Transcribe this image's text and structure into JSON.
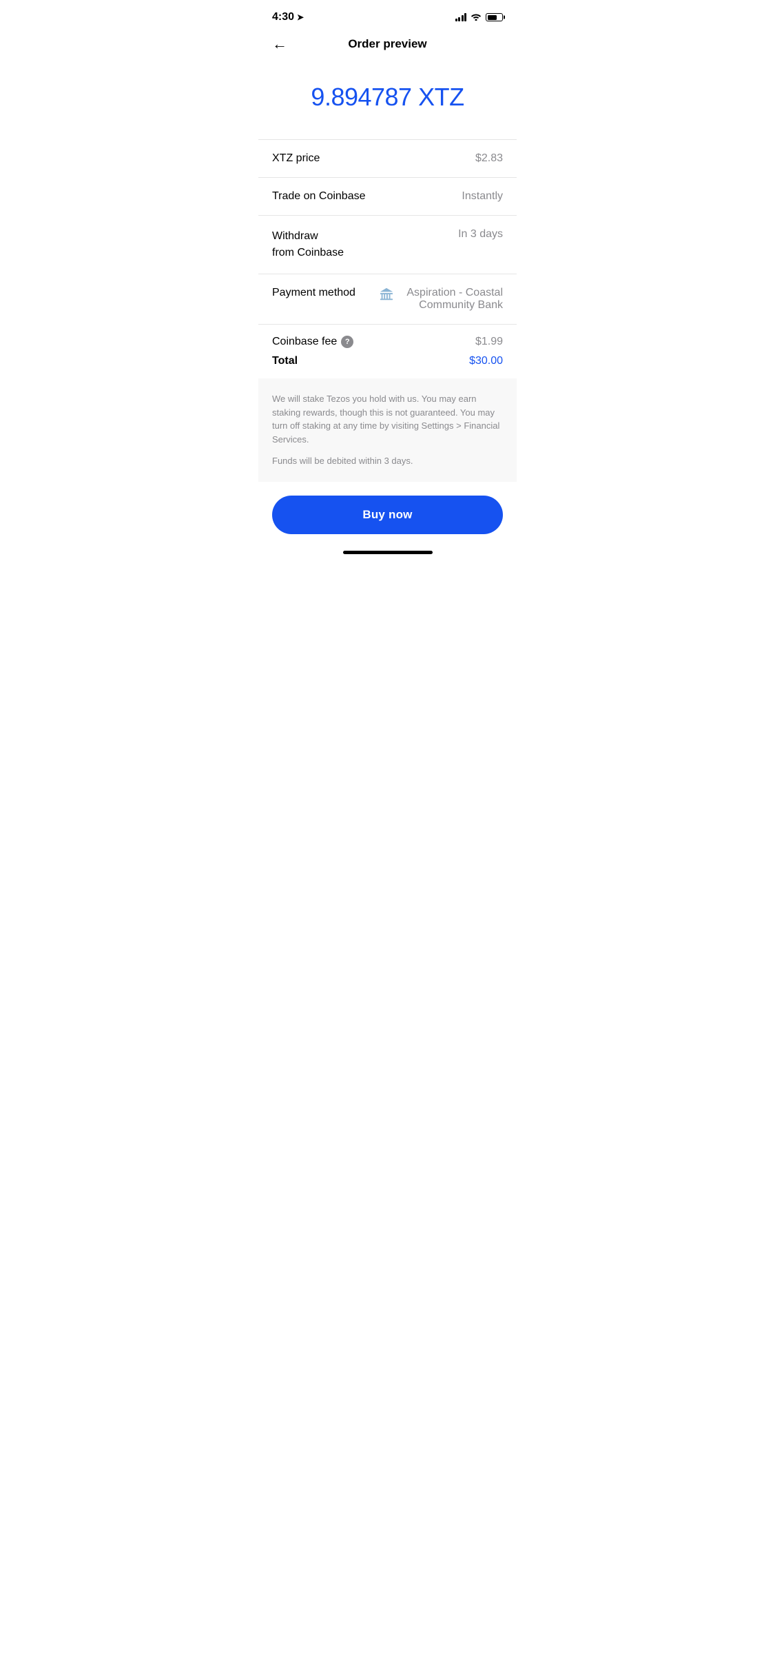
{
  "statusBar": {
    "time": "4:30",
    "locationIcon": "➤"
  },
  "header": {
    "backLabel": "←",
    "title": "Order preview"
  },
  "amount": {
    "value": "9.894787 XTZ",
    "color": "#1652f0"
  },
  "details": [
    {
      "label": "XTZ price",
      "value": "$2.83",
      "type": "simple"
    },
    {
      "label": "Trade on Coinbase",
      "value": "Instantly",
      "type": "simple"
    },
    {
      "label": "Withdraw\nfrom Coinbase",
      "value": "In 3 days",
      "type": "multi"
    }
  ],
  "paymentMethod": {
    "label": "Payment method",
    "bankIcon": "bank",
    "bankName": "Aspiration - Coastal Community Bank"
  },
  "fee": {
    "label": "Coinbase fee",
    "helpIcon": "?",
    "value": "$1.99"
  },
  "total": {
    "label": "Total",
    "value": "$30.00"
  },
  "disclaimer": {
    "staking": "We will stake Tezos you hold with us. You may earn staking rewards, though this is not guaranteed. You may turn off staking at any time by visiting Settings > Financial Services.",
    "funds": "Funds will be debited within 3 days."
  },
  "buyButton": {
    "label": "Buy now"
  }
}
